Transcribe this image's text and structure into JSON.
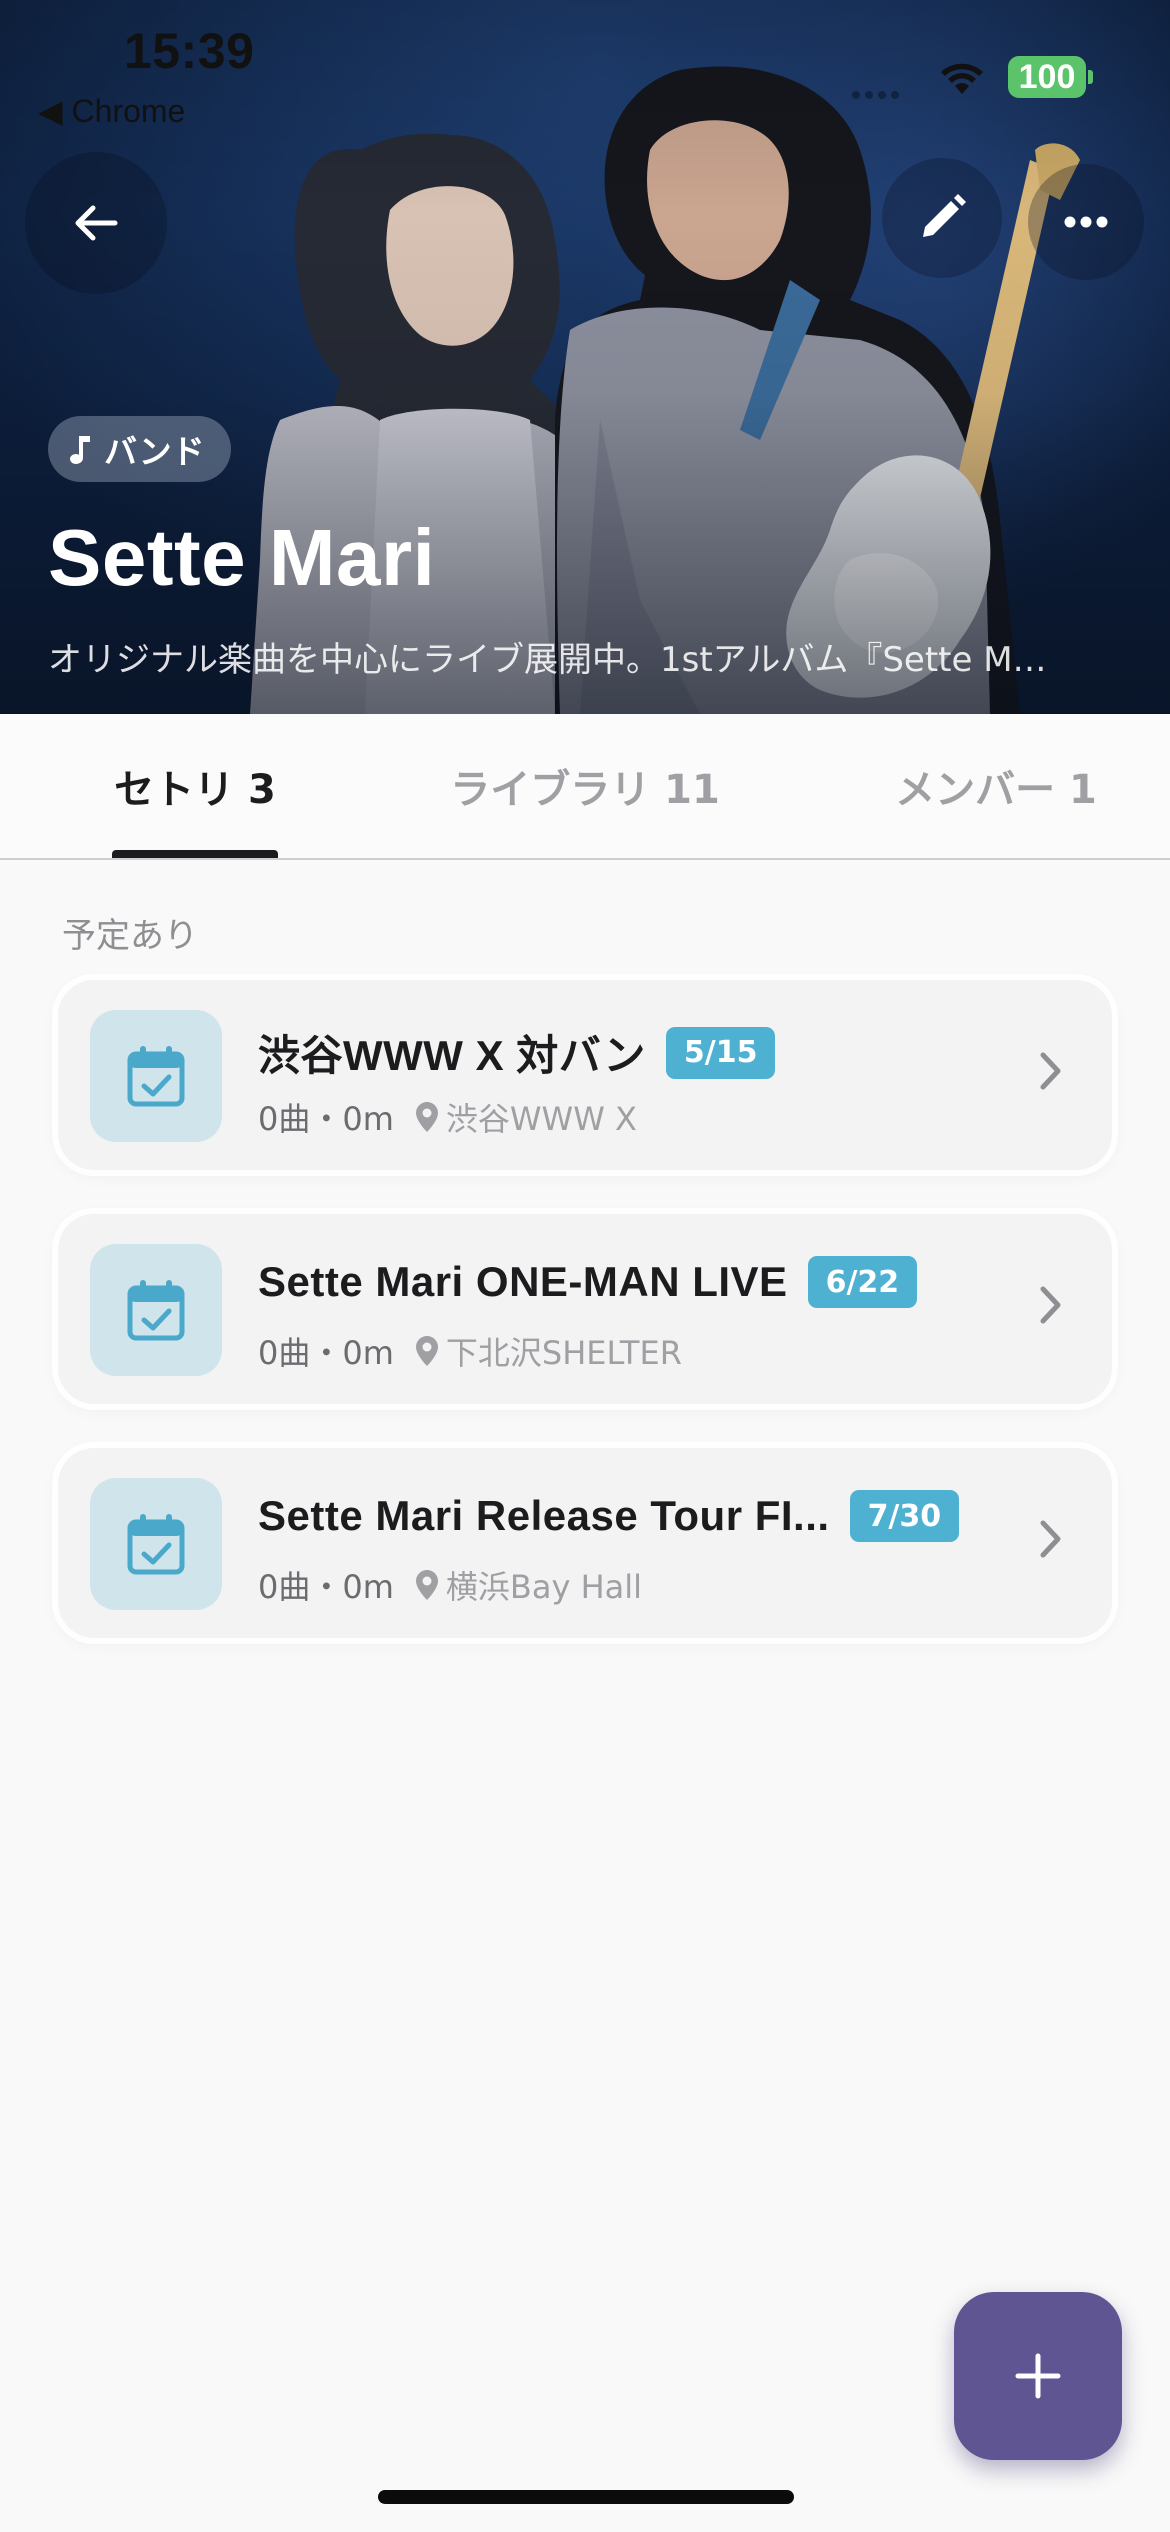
{
  "status_bar": {
    "time": "15:39",
    "back_app": "◀ Chrome",
    "battery": "100"
  },
  "header": {
    "type_chip": "バンド",
    "name": "Sette Mari",
    "description": "オリジナル楽曲を中心にライブ展開中。1stアルバム『Sette M…"
  },
  "icons": {
    "back": "arrow-left-icon",
    "edit": "pencil-icon",
    "more": "more-horizontal-icon",
    "music": "music-note-icon",
    "calendar": "calendar-check-icon",
    "location": "location-pin-icon",
    "chevron": "chevron-right-icon",
    "add": "plus-icon"
  },
  "tabs": [
    {
      "label": "セトリ 3"
    },
    {
      "label": "ライブラリ 11"
    },
    {
      "label": "メンバー 1"
    }
  ],
  "section": {
    "label": "予定あり"
  },
  "setlists": [
    {
      "title": "渋谷WWW X 対バン",
      "date": "5/15",
      "songs": "0曲・0m",
      "venue": "渋谷WWW X"
    },
    {
      "title": "Sette Mari ONE-MAN LIVE",
      "date": "6/22",
      "songs": "0曲・0m",
      "venue": "下北沢SHELTER"
    },
    {
      "title": "Sette Mari Release Tour FI...",
      "date": "7/30",
      "songs": "0曲・0m",
      "venue": "横浜Bay Hall"
    }
  ],
  "colors": {
    "accent_badge": "#4fb1d2",
    "icon_tile": "#cfe4eb",
    "fab": "#5f5592",
    "battery": "#5bc46a"
  }
}
